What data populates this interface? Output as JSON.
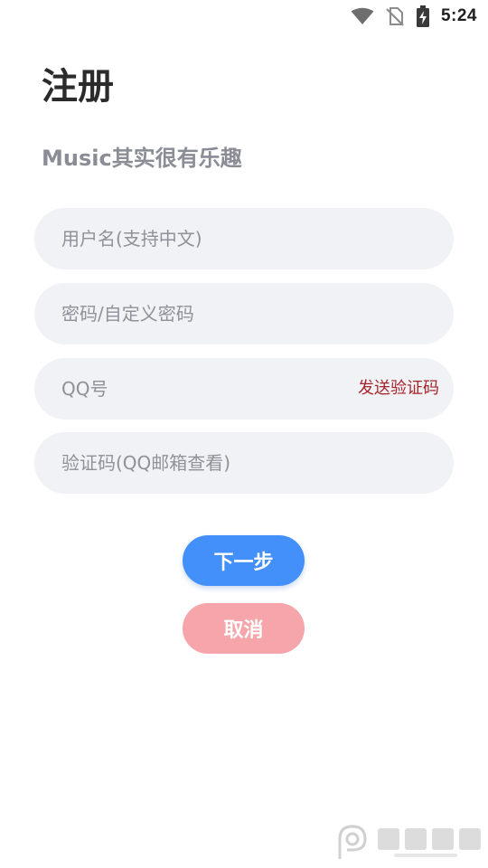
{
  "status_bar": {
    "time": "5:24",
    "icons": [
      "wifi-icon",
      "no-sim-icon",
      "battery-charging-icon"
    ]
  },
  "header": {
    "title": "注册",
    "subtitle": "Music其实很有乐趣"
  },
  "form": {
    "username_placeholder": "用户名(支持中文)",
    "password_placeholder": "密码/自定义密码",
    "qq_placeholder": "QQ号",
    "send_code_label": "发送验证码",
    "code_placeholder": "验证码(QQ邮箱查看)"
  },
  "actions": {
    "next_label": "下一步",
    "cancel_label": "取消"
  },
  "colors": {
    "accent_blue": "#4390fa",
    "cancel_pink": "#f6a5aa",
    "send_code_red": "#a6252a",
    "field_bg": "#f1f2f6"
  }
}
